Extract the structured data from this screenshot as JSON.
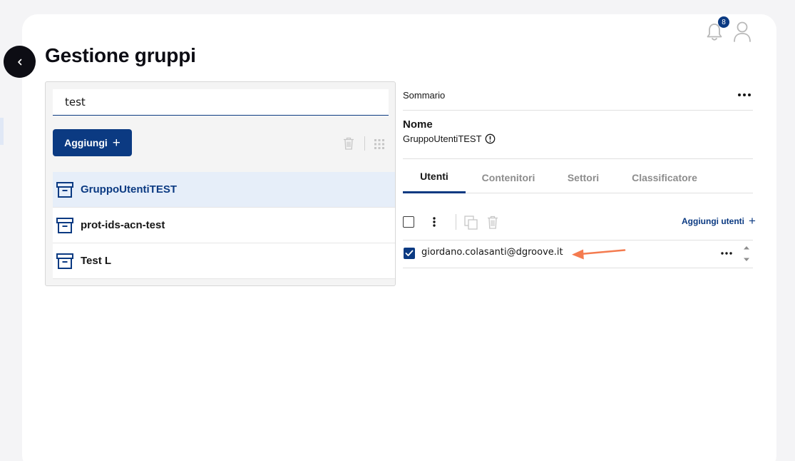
{
  "notifications": {
    "count": "8"
  },
  "page": {
    "title": "Gestione gruppi"
  },
  "left_panel": {
    "search_value": "test",
    "add_label": "Aggiungi",
    "groups": [
      {
        "name": "GruppoUtentiTEST",
        "selected": true
      },
      {
        "name": "prot-ids-acn-test",
        "selected": false
      },
      {
        "name": "Test L",
        "selected": false
      }
    ]
  },
  "summary": {
    "label": "Sommario",
    "name_label": "Nome",
    "name_value": "GruppoUtentiTEST"
  },
  "tabs": [
    {
      "label": "Utenti",
      "active": true
    },
    {
      "label": "Contenitori",
      "active": false
    },
    {
      "label": "Settori",
      "active": false
    },
    {
      "label": "Classificatore",
      "active": false
    }
  ],
  "users_toolbar": {
    "add_users_label": "Aggiungi utenti"
  },
  "users": [
    {
      "email": "giordano.colasanti@dgroove.it",
      "checked": true
    }
  ],
  "colors": {
    "primary": "#0b3a82",
    "selected_row": "#e6eef9",
    "annotation_arrow": "#f47b4f"
  },
  "icons": [
    "chevron-left-icon",
    "bell-icon",
    "user-icon",
    "trash-icon",
    "grid-icon",
    "archive-box-icon",
    "more-horizontal-icon",
    "info-circle-icon",
    "more-vertical-icon",
    "copy-icon",
    "checkmark-icon",
    "caret-up-icon",
    "caret-down-icon",
    "arrow-left-icon"
  ]
}
